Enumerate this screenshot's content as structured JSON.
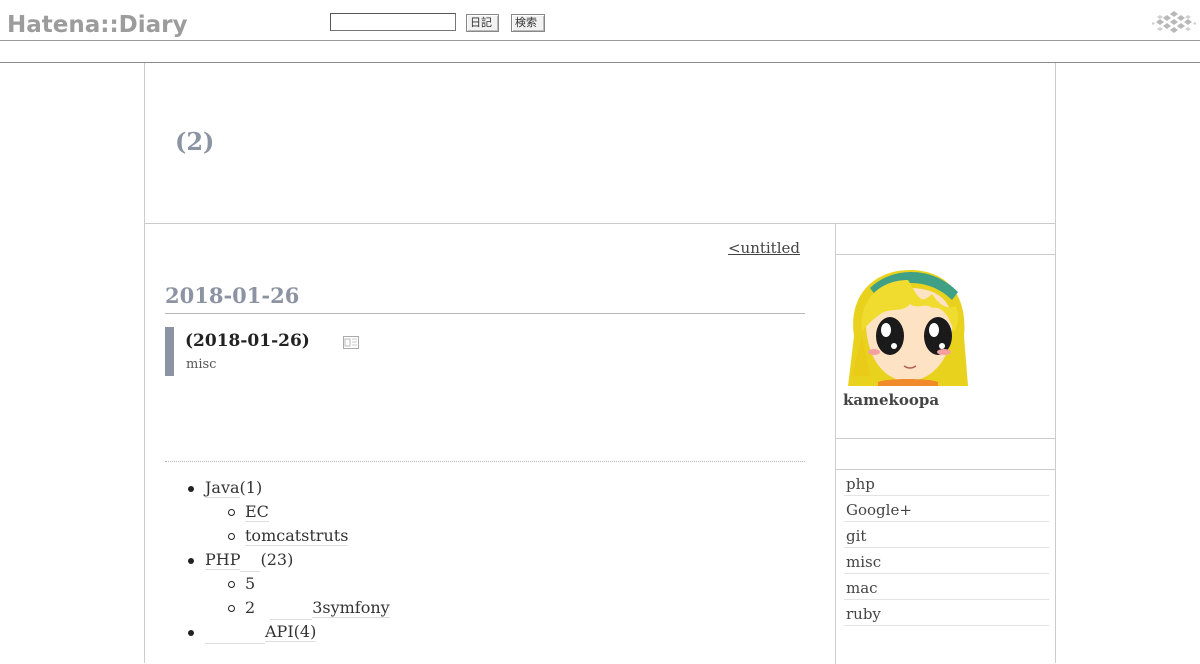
{
  "topbar": {
    "logo_text": "Hatena::Diary",
    "search_value": "",
    "diary_button_label": "日記",
    "search_button_label": "検索"
  },
  "diary": {
    "title": "(2)"
  },
  "main": {
    "prev_link": "<untitled",
    "day_heading": "2018-01-26",
    "section_title": "(2018-01-26)",
    "section_category": "misc",
    "tree": [
      {
        "label": "Java",
        "count": "(1)",
        "children": [
          "EC",
          "tomcatstruts"
        ]
      },
      {
        "label": "PHP",
        "count": "(23)",
        "children": [
          "5",
          "2",
          "3symfony"
        ]
      },
      {
        "label": "",
        "count": "API(4)",
        "children": []
      }
    ]
  },
  "sidebar": {
    "profile_name": "kamekoopa",
    "categories": [
      "php",
      "Google+",
      "git",
      "misc",
      "mac",
      "ruby"
    ]
  },
  "colors": {
    "heading": "#8c93a3",
    "logo": "#9c9c9c"
  }
}
